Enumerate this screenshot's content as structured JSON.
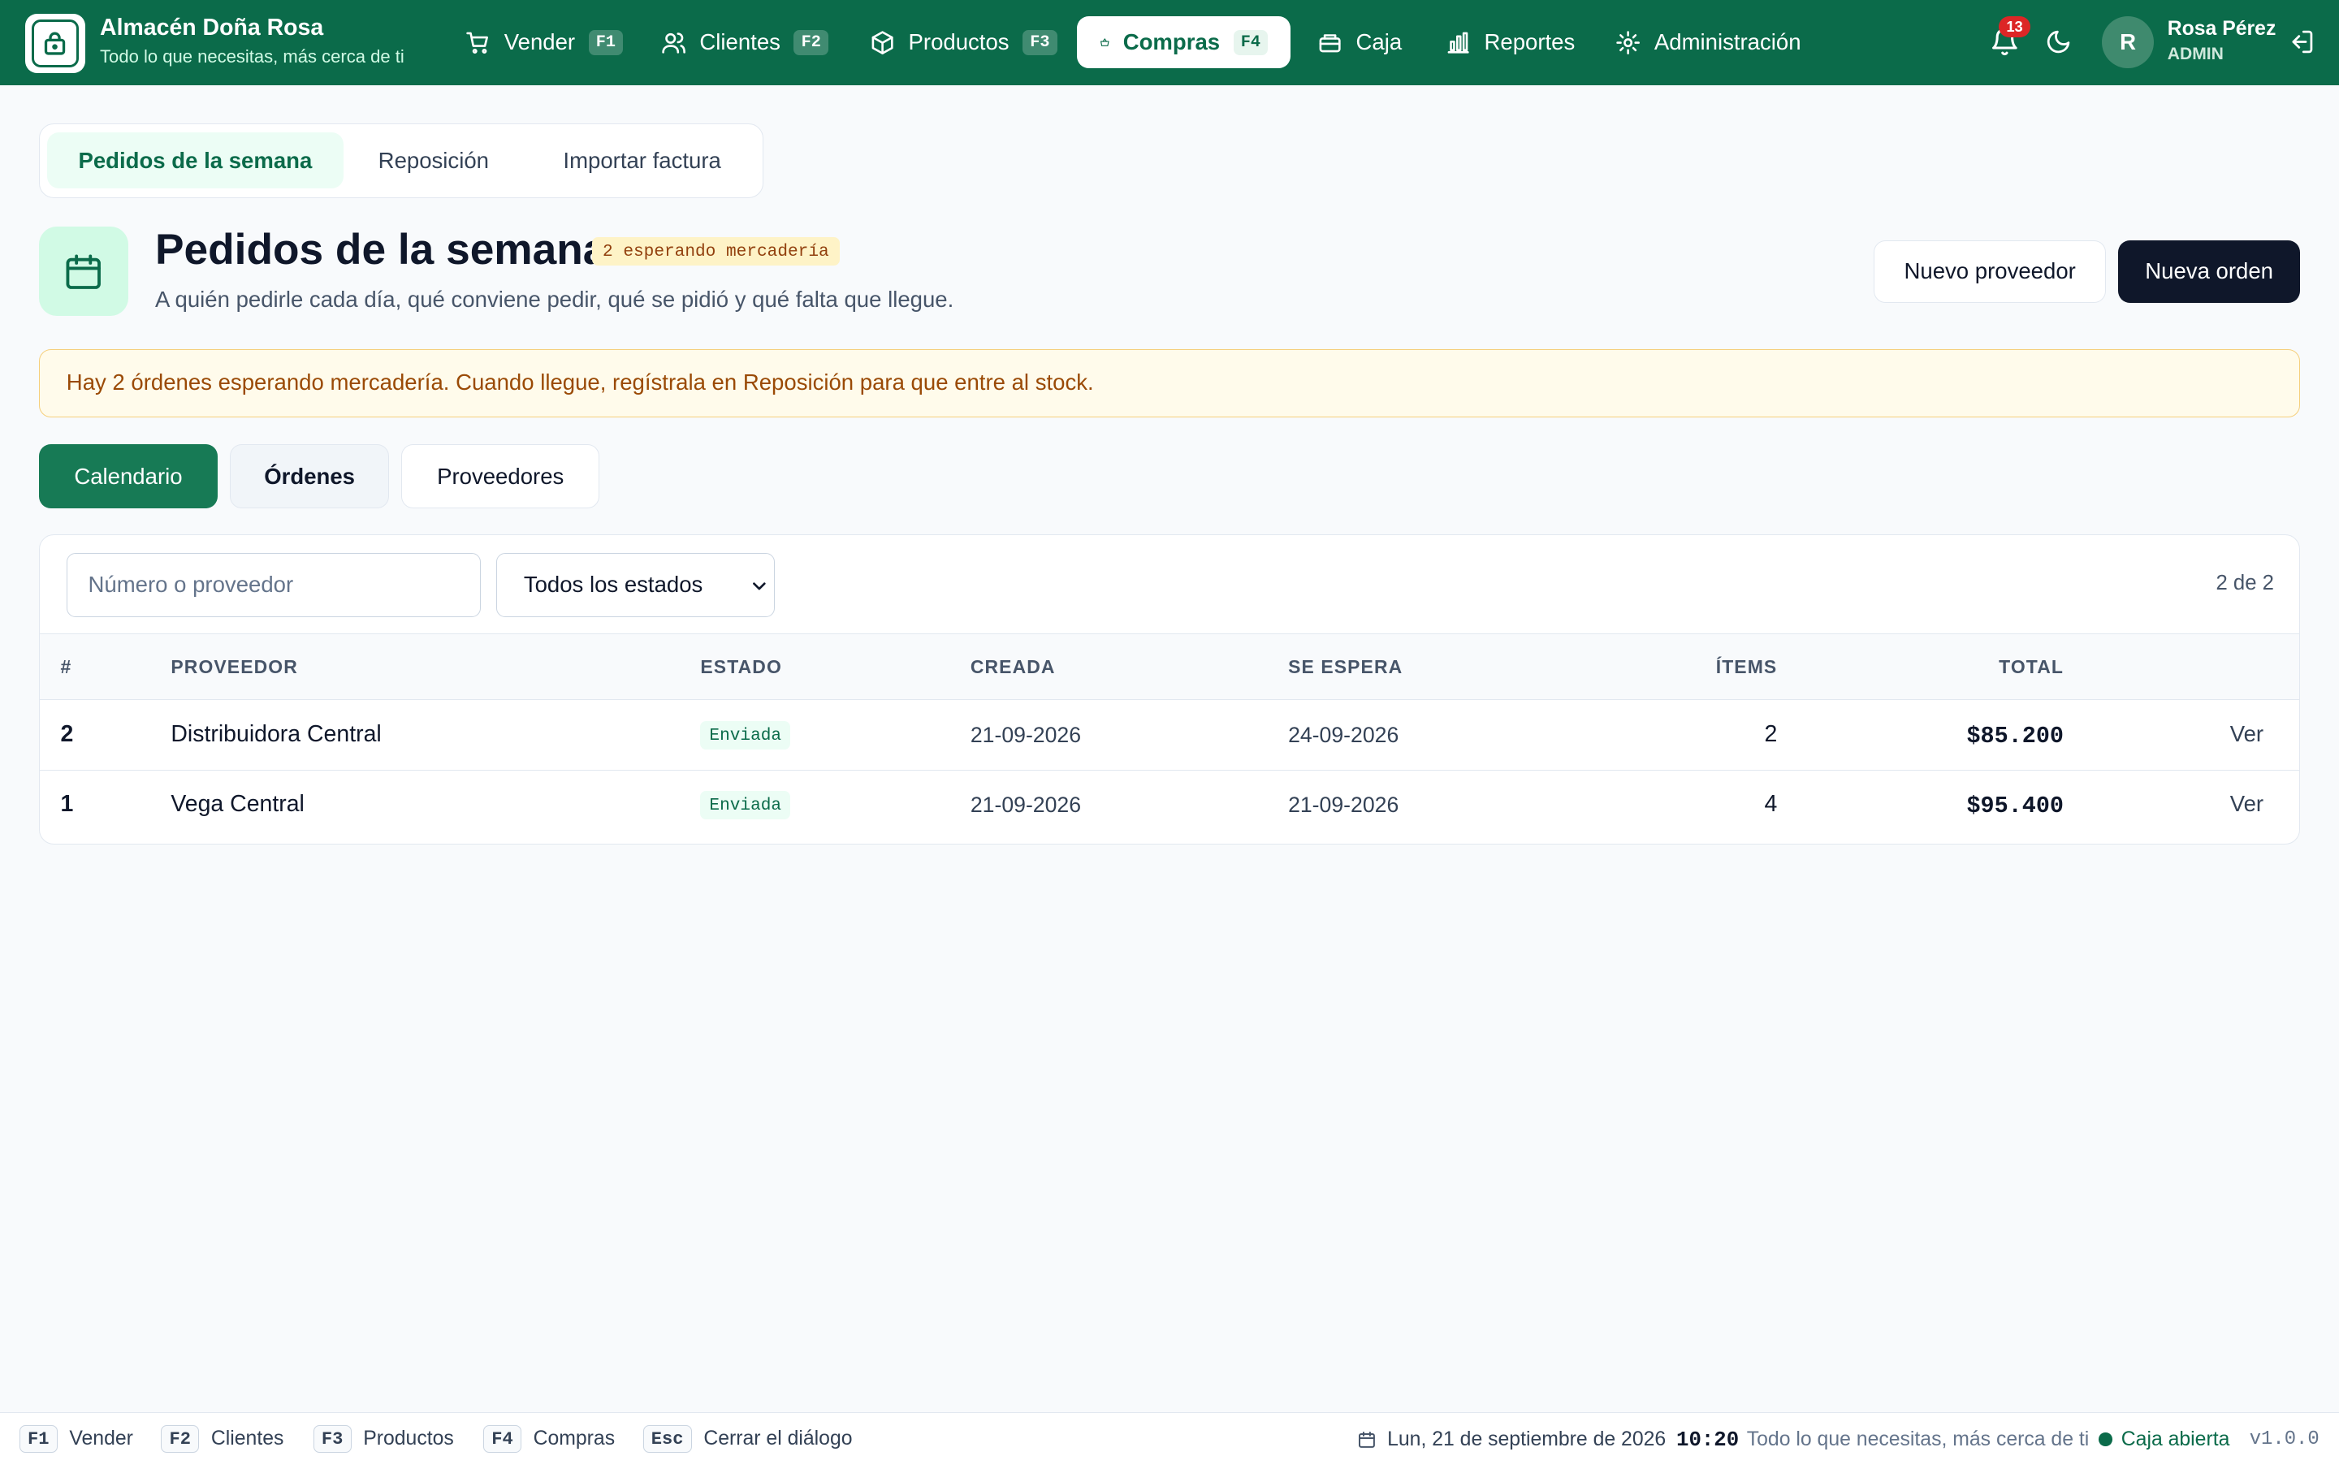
{
  "brand": {
    "name": "Almacén Doña Rosa",
    "tagline": "Todo lo que necesitas, más cerca de ti"
  },
  "nav": [
    {
      "label": "Vender",
      "key": "F1",
      "icon": "cart-icon"
    },
    {
      "label": "Clientes",
      "key": "F2",
      "icon": "users-icon"
    },
    {
      "label": "Productos",
      "key": "F3",
      "icon": "box-icon"
    },
    {
      "label": "Compras",
      "key": "F4",
      "icon": "basket-icon",
      "active": true
    },
    {
      "label": "Caja",
      "icon": "register-icon"
    },
    {
      "label": "Reportes",
      "icon": "bar-chart-icon"
    },
    {
      "label": "Administración",
      "icon": "settings-icon"
    }
  ],
  "notifications": {
    "count": "13"
  },
  "user": {
    "initial": "R",
    "name": "Rosa Pérez",
    "role": "ADMIN"
  },
  "subtabs": [
    {
      "label": "Pedidos de la semana",
      "active": true
    },
    {
      "label": "Reposición"
    },
    {
      "label": "Importar factura"
    }
  ],
  "page": {
    "title": "Pedidos de la semana",
    "badge": "2 esperando mercadería",
    "subtitle": "A quién pedirle cada día, qué conviene pedir, qué se pidió y qué falta que llegue.",
    "new_supplier": "Nuevo proveedor",
    "new_order": "Nueva orden"
  },
  "alert": "Hay 2 órdenes esperando mercadería. Cuando llegue, regístrala en Reposición para que entre al stock.",
  "views": {
    "calendar": "Calendario",
    "orders": "Órdenes",
    "suppliers": "Proveedores"
  },
  "filters": {
    "search_placeholder": "Número o proveedor",
    "status": "Todos los estados",
    "count": "2 de 2"
  },
  "table": {
    "headers": {
      "num": "#",
      "supplier": "PROVEEDOR",
      "status": "ESTADO",
      "created": "CREADA",
      "expected": "SE ESPERA",
      "items": "ÍTEMS",
      "total": "TOTAL"
    },
    "rows": [
      {
        "num": "2",
        "supplier": "Distribuidora Central",
        "status": "Enviada",
        "created": "21-09-2026",
        "expected": "24-09-2026",
        "items": "2",
        "total": "$85.200",
        "action": "Ver"
      },
      {
        "num": "1",
        "supplier": "Vega Central",
        "status": "Enviada",
        "created": "21-09-2026",
        "expected": "21-09-2026",
        "items": "4",
        "total": "$95.400",
        "action": "Ver"
      }
    ]
  },
  "footer": {
    "shortcuts": [
      {
        "key": "F1",
        "label": "Vender"
      },
      {
        "key": "F2",
        "label": "Clientes"
      },
      {
        "key": "F3",
        "label": "Productos"
      },
      {
        "key": "F4",
        "label": "Compras"
      },
      {
        "key": "Esc",
        "label": "Cerrar el diálogo"
      }
    ],
    "date": "Lun, 21 de septiembre de 2026",
    "time": "10:20",
    "tagline": "Todo lo que necesitas, más cerca de ti",
    "status": "Caja abierta",
    "version": "v1.0.0"
  },
  "colors": {
    "brand": "#0b6b4a",
    "dark_button": "#0f172a",
    "alert_bg": "#fffbeb",
    "alert_text": "#9a4a06",
    "badge_red": "#dc2626"
  }
}
